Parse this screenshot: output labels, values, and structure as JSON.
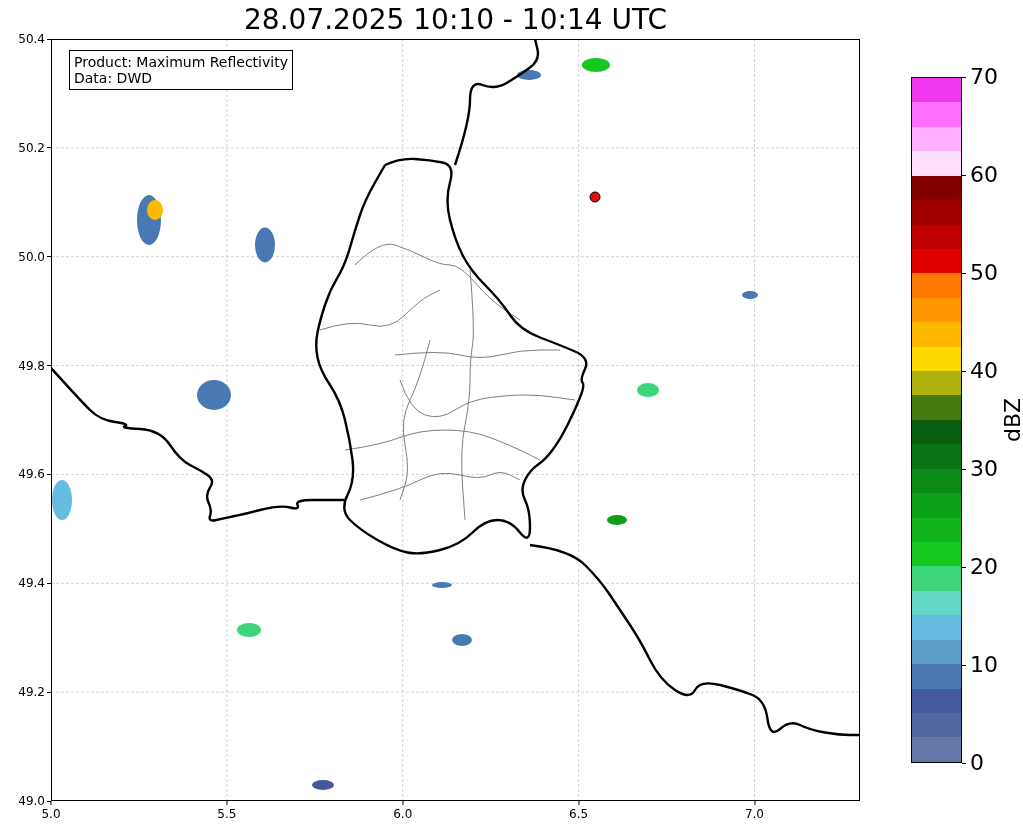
{
  "title": "28.07.2025 10:10 - 10:14 UTC",
  "info_box": [
    "Product: Maximum Reflectivity",
    "Data: DWD"
  ],
  "map": {
    "xticks": [
      "5.0",
      "5.5",
      "6.0",
      "6.5",
      "7.0"
    ],
    "yticks": [
      "50.4",
      "50.2",
      "50.0",
      "49.8",
      "49.6",
      "49.4",
      "49.2",
      "49.0"
    ]
  },
  "colorbar": {
    "label": "dBZ",
    "ticks": [
      "70",
      "60",
      "50",
      "40",
      "30",
      "20",
      "10",
      "0"
    ],
    "segments": [
      {
        "color": "#f038f0"
      },
      {
        "color": "#ff70ff"
      },
      {
        "color": "#ffb0ff"
      },
      {
        "color": "#ffe0ff"
      },
      {
        "color": "#800000"
      },
      {
        "color": "#a00000"
      },
      {
        "color": "#c00000"
      },
      {
        "color": "#e00000"
      },
      {
        "color": "#ff7800"
      },
      {
        "color": "#ff9800"
      },
      {
        "color": "#ffb800"
      },
      {
        "color": "#ffd800"
      },
      {
        "color": "#b0b010"
      },
      {
        "color": "#477a10"
      },
      {
        "color": "#0a5e10"
      },
      {
        "color": "#0a7414"
      },
      {
        "color": "#0c8a16"
      },
      {
        "color": "#0fa01a"
      },
      {
        "color": "#12b41e"
      },
      {
        "color": "#14c820"
      },
      {
        "color": "#3ed678"
      },
      {
        "color": "#64d8c8"
      },
      {
        "color": "#66bce0"
      },
      {
        "color": "#5a9ec8"
      },
      {
        "color": "#4978b2"
      },
      {
        "color": "#4459a0"
      },
      {
        "color": "#5266a0"
      },
      {
        "color": "#6478a8"
      }
    ]
  }
}
